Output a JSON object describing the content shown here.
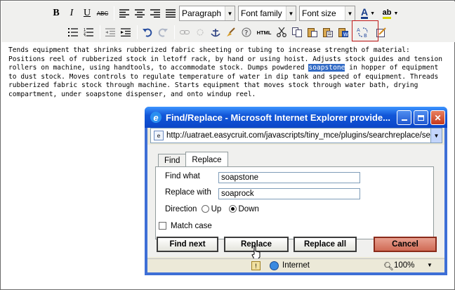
{
  "toolbar": {
    "row1": {
      "bold": "B",
      "italic": "I",
      "underline": "U",
      "strike": "ABC",
      "format_select": "Paragraph",
      "font_family_select": "Font family",
      "font_size_select": "Font size",
      "fore_color": "A",
      "back_color": "ab"
    },
    "row2": {
      "html": "HTML"
    }
  },
  "content": {
    "before": "Tends equipment that shrinks rubberized fabric sheeting or tubing to increase strength of material: Positions reel of rubberized stock in letoff rack, by hand or using hoist. Adjusts stock guides and tension rollers on machine, using handtools, to accommodate stock. Dumps powdered ",
    "selected": "soapstone",
    "after": " in hopper of equipment to dust stock. Moves controls to regulate temperature of water in dip tank and speed of equipment. Threads rubberized fabric stock through machine. Starts equipment that moves stock through water bath, drying compartment, under soapstone dispenser, and onto windup reel."
  },
  "dialog": {
    "title": "Find/Replace - Microsoft Internet Explorer provide...",
    "address": "http://uatraet.easycruit.com/javascripts/tiny_mce/plugins/searchreplace/searc",
    "tabs": [
      "Find",
      "Replace"
    ],
    "find_label": "Find what",
    "find_value": "soapstone",
    "replace_label": "Replace with",
    "replace_value": "soaprock",
    "direction_label": "Direction",
    "up_label": "Up",
    "down_label": "Down",
    "match_case_label": "Match case",
    "buttons": {
      "find_next": "Find next",
      "replace": "Replace",
      "replace_all": "Replace all",
      "cancel": "Cancel"
    },
    "status": {
      "zone": "Internet",
      "zoom": "100%"
    }
  }
}
